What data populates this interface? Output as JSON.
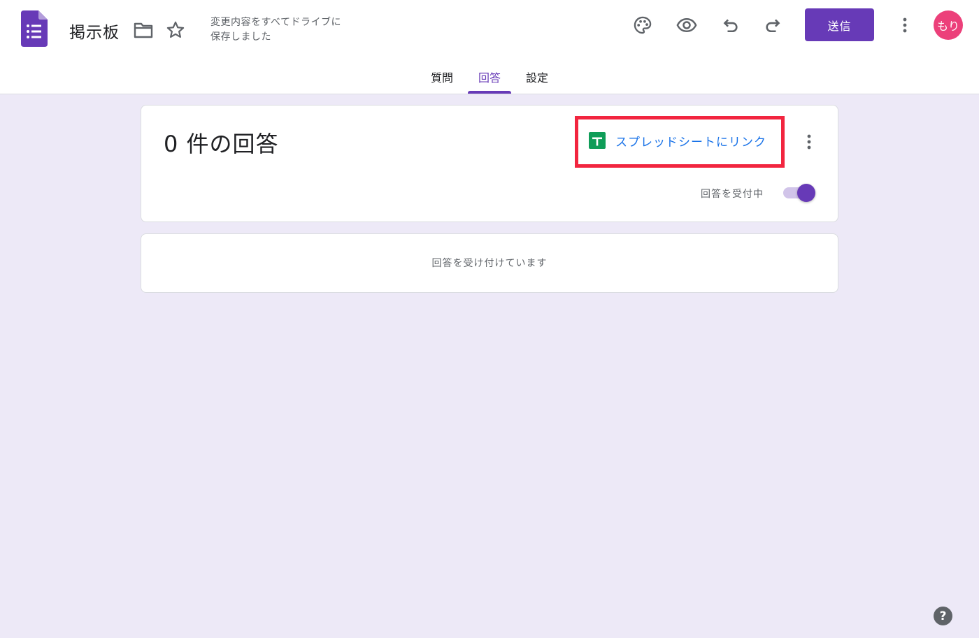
{
  "header": {
    "title": "掲示板",
    "save_status_line1": "変更内容をすべてドライブに",
    "save_status_line2": "保存しました",
    "send_label": "送信",
    "avatar_text": "もり"
  },
  "tabs": [
    {
      "label": "質問",
      "active": false
    },
    {
      "label": "回答",
      "active": true
    },
    {
      "label": "設定",
      "active": false
    }
  ],
  "summary": {
    "count_text": "0 件の回答",
    "link_label": "スプレッドシートにリンク",
    "accepting_label": "回答を受付中",
    "accepting_on": true
  },
  "status": {
    "message": "回答を受け付けています"
  },
  "help": {
    "glyph": "?"
  },
  "colors": {
    "brand": "#673ab7",
    "background": "#ede9f7",
    "highlight": "#f2253f",
    "link": "#1a73e8",
    "sheets_green": "#0f9d58",
    "avatar": "#ec407a"
  }
}
